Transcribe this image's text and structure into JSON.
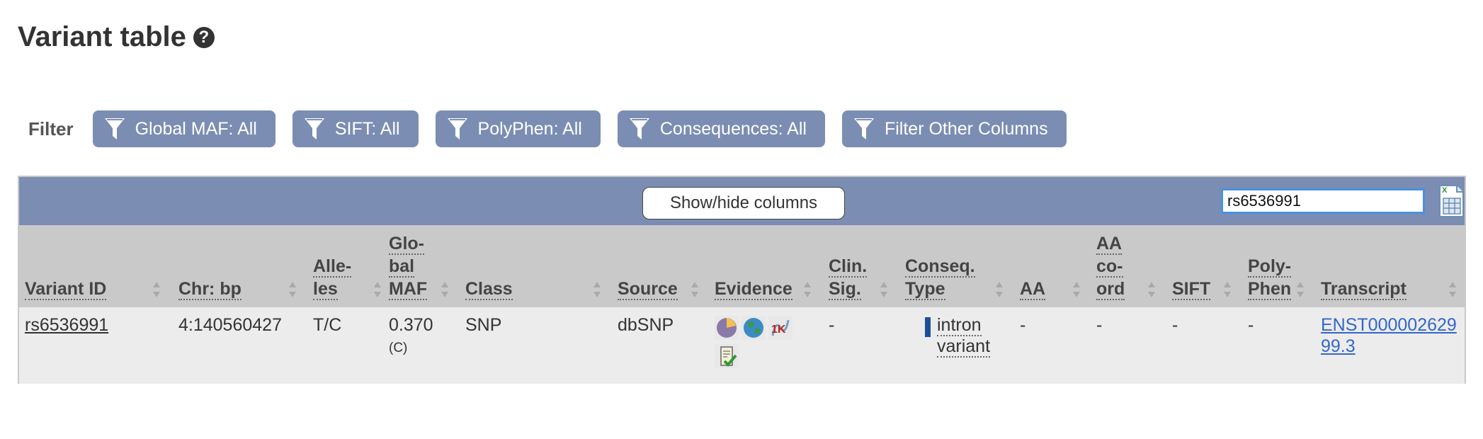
{
  "page": {
    "title": "Variant table",
    "help_icon": "help-icon"
  },
  "filters": {
    "label": "Filter",
    "buttons": [
      "Global MAF: All",
      "SIFT: All",
      "PolyPhen: All",
      "Consequences: All",
      "Filter Other Columns"
    ]
  },
  "toolbar": {
    "showhide_label": "Show/hide columns",
    "search_value": "rs6536991",
    "export_icon": "excel-export-icon"
  },
  "columns": [
    [
      "Variant ID"
    ],
    [
      "Chr: bp"
    ],
    [
      "Alle-",
      "les"
    ],
    [
      "Glo-",
      "bal",
      "MAF"
    ],
    [
      "Class"
    ],
    [
      "Source"
    ],
    [
      "Evidence"
    ],
    [
      "Clin.",
      "Sig."
    ],
    [
      "Conseq.",
      "Type"
    ],
    [
      "AA"
    ],
    [
      "AA",
      "co-",
      "ord"
    ],
    [
      "SIFT"
    ],
    [
      "Poly-",
      "Phen"
    ],
    [
      "Transcript"
    ]
  ],
  "row": {
    "variant_id": "rs6536991",
    "chr_bp": "4:140560427",
    "alleles": "T/C",
    "maf": "0.370",
    "maf_allele": "(C)",
    "class": "SNP",
    "source": "dbSNP",
    "evidence_icons": [
      "frequency-icon",
      "hapmap-icon",
      "1000genomes-icon",
      "cited-icon"
    ],
    "evidence_1kg_text": "1K",
    "clin_sig": "-",
    "conseq_line1": "intron",
    "conseq_line2": "variant",
    "conseq_color": "#1f4e99",
    "aa": "-",
    "aa_coord": "-",
    "sift": "-",
    "polyphen": "-",
    "transcript_line1": "ENST000002629",
    "transcript_line2": "99.3"
  },
  "colors": {
    "header_bar": "#7b8db2",
    "thead": "#c9c9c9",
    "row": "#ececec",
    "link": "#3366cc"
  }
}
